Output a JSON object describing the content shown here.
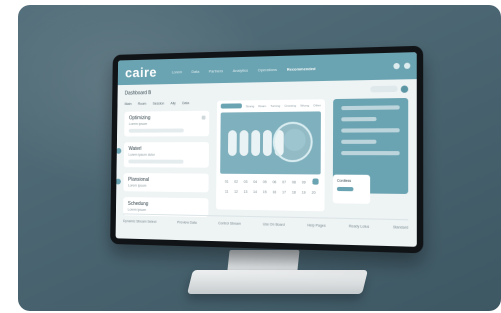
{
  "app": {
    "logo": "caire",
    "header_title": "Dashboard B"
  },
  "nav": [
    "Lorem",
    "Data",
    "Partners",
    "Analytics",
    "Operations",
    "Recommended"
  ],
  "nav_active_index": 5,
  "tabs": [
    "Main",
    "Room",
    "Session",
    "Ally",
    "Data"
  ],
  "cards": [
    {
      "title": "Optimizing",
      "subtitle": "Lorem ipsum"
    },
    {
      "title": "Waterl",
      "subtitle": "Lorem ipsum dolor"
    },
    {
      "title": "Plansional",
      "subtitle": "Lorem ipsum"
    },
    {
      "title": "Schedung",
      "subtitle": "Lorem ipsum"
    }
  ],
  "center": {
    "columns": [
      "Strang",
      "Roam",
      "Turning",
      "Crossing",
      "Wrong",
      "Other"
    ],
    "grid_values": [
      "01",
      "02",
      "03",
      "04",
      "05",
      "06",
      "07",
      "08",
      "09",
      "10",
      "11",
      "12",
      "13",
      "14",
      "15",
      "16",
      "17",
      "18",
      "19",
      "20"
    ]
  },
  "right_small": {
    "title": "Cordless"
  },
  "bottom": [
    "Dynamic Stream Select",
    "Preview Data",
    "Control Stream",
    "Use On Board",
    "Help Pages",
    "Ready Lotus",
    "Standard"
  ],
  "colors": {
    "accent": "#6aa3b1",
    "frame": "#4a6571",
    "screen_bg": "#eef3f4"
  }
}
